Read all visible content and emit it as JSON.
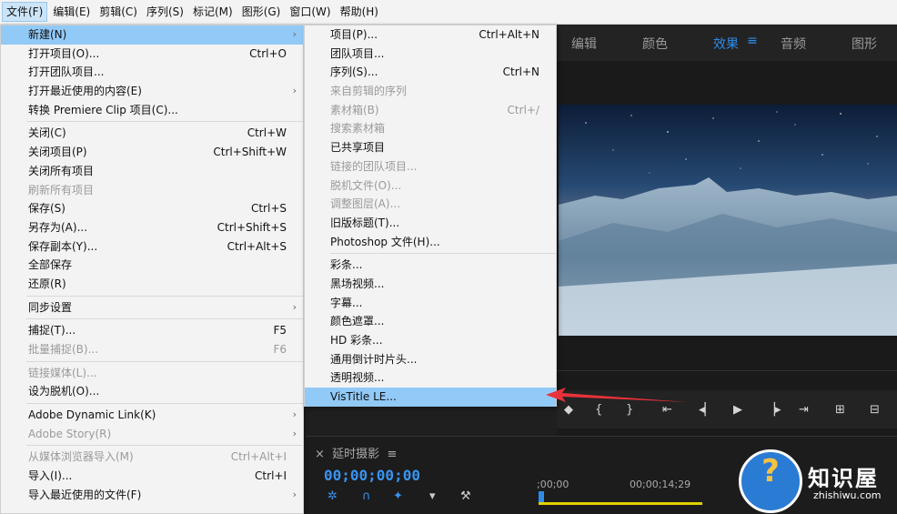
{
  "menubar": {
    "items": [
      "文件(F)",
      "编辑(E)",
      "剪辑(C)",
      "序列(S)",
      "标记(M)",
      "图形(G)",
      "窗口(W)",
      "帮助(H)"
    ]
  },
  "workspace_tabs": {
    "edit": "编辑",
    "color": "颜色",
    "effects": "效果",
    "audio": "音频",
    "graphics": "图形"
  },
  "file_menu": [
    {
      "label": "新建(N)",
      "shortcut": "",
      "submenu": true
    },
    {
      "label": "打开项目(O)...",
      "shortcut": "Ctrl+O"
    },
    {
      "label": "打开团队项目...",
      "shortcut": ""
    },
    {
      "label": "打开最近使用的内容(E)",
      "shortcut": "",
      "submenu": true
    },
    {
      "label": "转换 Premiere Clip 项目(C)...",
      "shortcut": ""
    },
    {
      "label": "关闭(C)",
      "shortcut": "Ctrl+W"
    },
    {
      "label": "关闭项目(P)",
      "shortcut": "Ctrl+Shift+W"
    },
    {
      "label": "关闭所有项目",
      "shortcut": ""
    },
    {
      "label": "刷新所有项目",
      "shortcut": "",
      "disabled": true
    },
    {
      "label": "保存(S)",
      "shortcut": "Ctrl+S"
    },
    {
      "label": "另存为(A)...",
      "shortcut": "Ctrl+Shift+S"
    },
    {
      "label": "保存副本(Y)...",
      "shortcut": "Ctrl+Alt+S"
    },
    {
      "label": "全部保存",
      "shortcut": ""
    },
    {
      "label": "还原(R)",
      "shortcut": ""
    },
    {
      "label": "同步设置",
      "shortcut": "",
      "submenu": true
    },
    {
      "label": "捕捉(T)...",
      "shortcut": "F5"
    },
    {
      "label": "批量捕捉(B)...",
      "shortcut": "F6",
      "disabled": true
    },
    {
      "label": "链接媒体(L)...",
      "shortcut": "",
      "disabled": true
    },
    {
      "label": "设为脱机(O)...",
      "shortcut": ""
    },
    {
      "label": "Adobe Dynamic Link(K)",
      "shortcut": "",
      "submenu": true
    },
    {
      "label": "Adobe Story(R)",
      "shortcut": "",
      "submenu": true,
      "disabled": true
    },
    {
      "label": "从媒体浏览器导入(M)",
      "shortcut": "Ctrl+Alt+I",
      "disabled": true
    },
    {
      "label": "导入(I)...",
      "shortcut": "Ctrl+I"
    },
    {
      "label": "导入最近使用的文件(F)",
      "shortcut": "",
      "submenu": true
    }
  ],
  "new_menu": [
    {
      "label": "项目(P)...",
      "shortcut": "Ctrl+Alt+N"
    },
    {
      "label": "团队项目...",
      "shortcut": ""
    },
    {
      "label": "序列(S)...",
      "shortcut": "Ctrl+N"
    },
    {
      "label": "来自剪辑的序列",
      "shortcut": "",
      "disabled": true
    },
    {
      "label": "素材箱(B)",
      "shortcut": "Ctrl+/",
      "disabled": true
    },
    {
      "label": "搜索素材箱",
      "shortcut": "",
      "disabled": true
    },
    {
      "label": "已共享项目",
      "shortcut": ""
    },
    {
      "label": "链接的团队项目...",
      "shortcut": "",
      "disabled": true
    },
    {
      "label": "脱机文件(O)...",
      "shortcut": "",
      "disabled": true
    },
    {
      "label": "调整图层(A)...",
      "shortcut": "",
      "disabled": true
    },
    {
      "label": "旧版标题(T)...",
      "shortcut": ""
    },
    {
      "label": "Photoshop 文件(H)...",
      "shortcut": ""
    },
    {
      "label": "彩条...",
      "shortcut": ""
    },
    {
      "label": "黑场视频...",
      "shortcut": ""
    },
    {
      "label": "字幕...",
      "shortcut": ""
    },
    {
      "label": "颜色遮罩...",
      "shortcut": ""
    },
    {
      "label": "HD 彩条...",
      "shortcut": ""
    },
    {
      "label": "通用倒计时片头...",
      "shortcut": ""
    },
    {
      "label": "透明视频...",
      "shortcut": ""
    },
    {
      "label": "VisTitle LE...",
      "shortcut": "",
      "highlight": true
    }
  ],
  "timeline": {
    "title": "延时摄影",
    "timecode": "00;00;00;00",
    "tick_start": ";00;00",
    "tick_mid": "00;00;14;29"
  },
  "watermark": {
    "brand": "知识屋",
    "url": "zhishiwu.com"
  },
  "colors": {
    "accent": "#2d8ceb",
    "menu_highlight": "#91c9f7",
    "arrow": "#e8323a"
  }
}
